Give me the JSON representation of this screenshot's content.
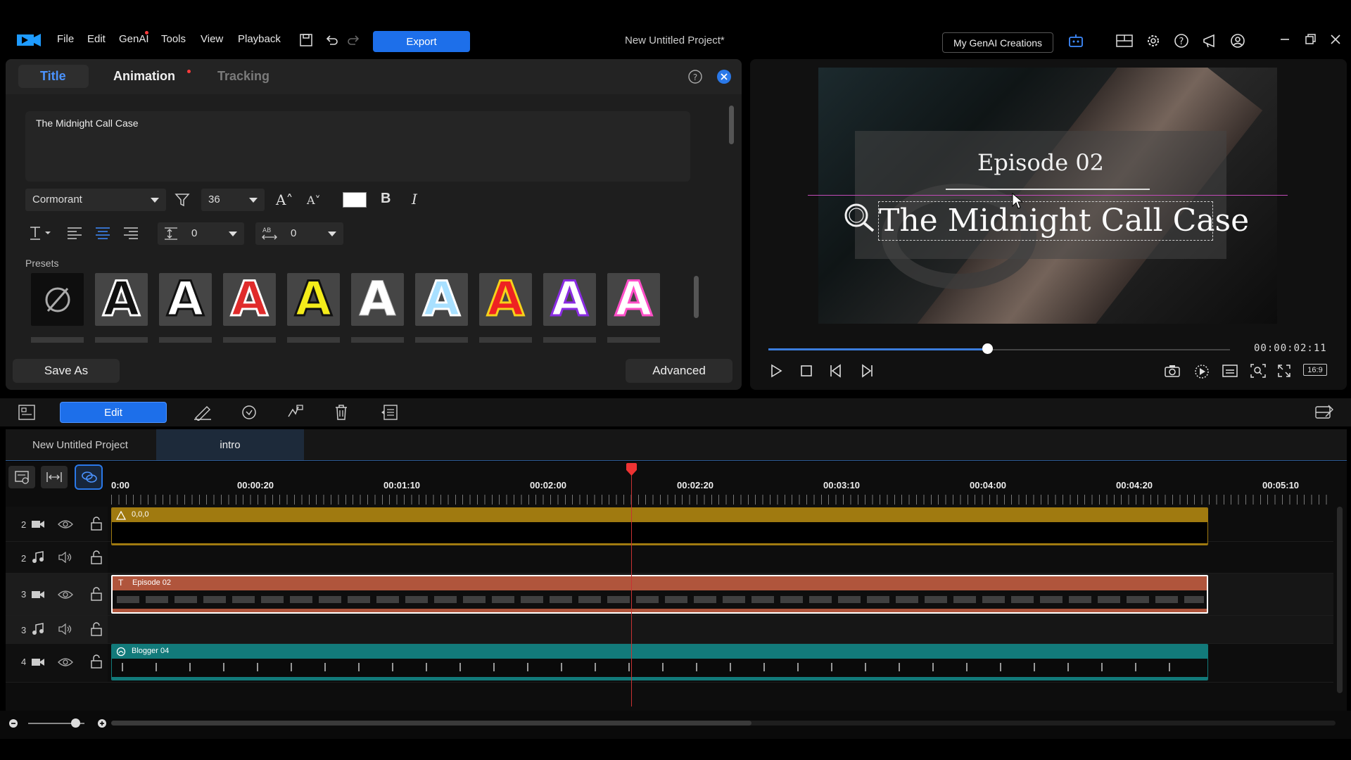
{
  "menu": {
    "items": [
      "File",
      "Edit",
      "GenAI",
      "Tools",
      "View",
      "Playback"
    ],
    "export_label": "Export",
    "project_title": "New Untitled Project*",
    "genai_creations_label": "My GenAI Creations"
  },
  "title_panel": {
    "tabs": [
      "Title",
      "Animation",
      "Tracking"
    ],
    "text_value": "The Midnight Call Case",
    "font_name": "Cormorant",
    "font_size": "36",
    "line_spacing": "0",
    "char_spacing": "0",
    "presets_label": "Presets",
    "save_as_label": "Save As",
    "advanced_label": "Advanced"
  },
  "preview": {
    "episode_text": "Episode 02",
    "title_text": "The Midnight Call Case",
    "timecode": "00:00:02:11",
    "progress": 0.474,
    "aspect_label": "16:9"
  },
  "timeline": {
    "edit_label": "Edit",
    "tabs": [
      "New Untitled Project",
      "intro"
    ],
    "ruler": [
      "0:00",
      "00:00:20",
      "00:01:10",
      "00:02:00",
      "00:02:20",
      "00:03:10",
      "00:04:00",
      "00:04:20",
      "00:05:10"
    ],
    "tracks": [
      {
        "num": "2",
        "type": "video",
        "clip": "0,0,0",
        "color": "#a07a10"
      },
      {
        "num": "2",
        "type": "audio"
      },
      {
        "num": "3",
        "type": "video",
        "clip": "Episode 02",
        "color": "#b0553c"
      },
      {
        "num": "3",
        "type": "audio"
      },
      {
        "num": "4",
        "type": "video",
        "clip": "Blogger 04",
        "color": "#127a7a"
      }
    ]
  },
  "colors": {
    "accent": "#1d6fea",
    "playhead": "#e33333"
  }
}
